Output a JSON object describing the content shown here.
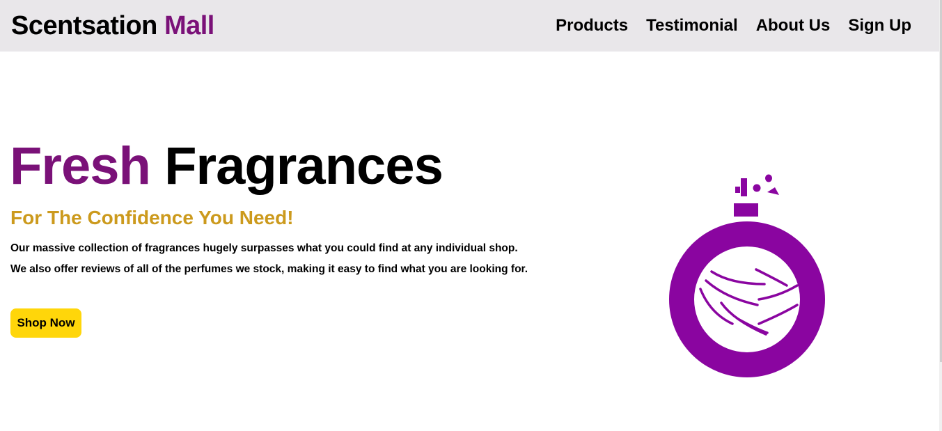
{
  "header": {
    "brand_first": "Scentsation",
    "brand_second": "Mall",
    "nav": [
      "Products",
      "Testimonial",
      "About Us",
      "Sign Up"
    ]
  },
  "hero": {
    "title_accent": "Fresh",
    "title_rest": "Fragrances",
    "subtitle": "For The Confidence You Need!",
    "line1": "Our massive collection of fragrances hugely surpasses what you could find at any individual shop.",
    "line2": "We also offer reviews of all of the perfumes we stock, making it easy to find what you are looking for.",
    "cta_label": "Shop Now",
    "illustration_icon": "perfume-bottle-icon"
  },
  "colors": {
    "brand_purple": "#7a1178",
    "icon_purple": "#8a05a0",
    "subtitle_gold": "#cc9a1d",
    "cta_yellow": "#ffd60a",
    "navbar_bg": "#e9e7ea"
  }
}
